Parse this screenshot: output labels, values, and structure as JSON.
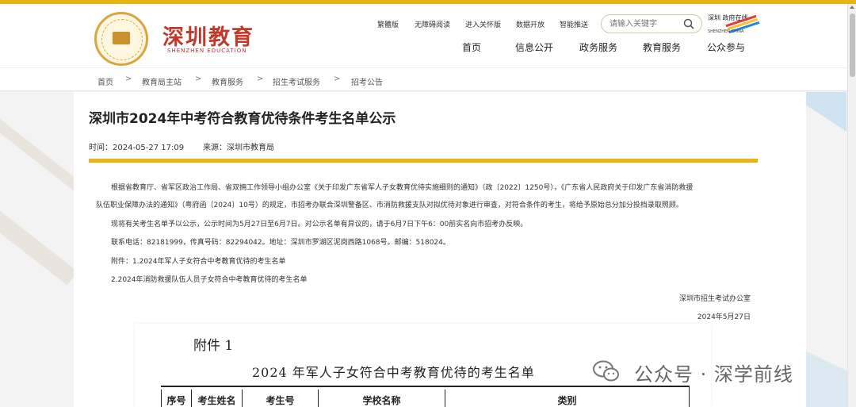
{
  "site": {
    "title": "深圳教育",
    "subtitle": "SHENZHEN EDUCATION",
    "badge_text": "深圳教育",
    "accent_color": "#e7b413",
    "brand_color": "#c0392b"
  },
  "utility_links": [
    "繁體版",
    "无障碍阅读",
    "进入关怀版",
    "数据开放",
    "智能推送"
  ],
  "search": {
    "placeholder": "请输入关键字",
    "icon": "search-icon"
  },
  "china_logo": {
    "text": "深圳 政府在线",
    "subtext": "SHENZHEN CHINA"
  },
  "nav": [
    "首页",
    "信息公开",
    "政务服务",
    "教育服务",
    "公众参与"
  ],
  "breadcrumb": [
    "首页",
    "教育局主站",
    "教育服务",
    "招生考试服务",
    "招考公告"
  ],
  "breadcrumb_separator": ">",
  "article": {
    "title": "深圳市2024年中考符合教育优待条件考生名单公示",
    "time": "时间：2024-05-27 17:09",
    "source": "来源：深圳市教育局",
    "paragraphs": [
      "根据省教育厅、省军区政治工作局、省双拥工作领导小组办公室《关于印发广东省军人子女教育优待实施细则的通知》（政〔2022〕1250号），《广东省人民政府关于印发广东省消防救援",
      "队伍职业保障办法的通知》（粤府函〔2024〕10号）的规定，市招考办联合深圳警备区、市消防救援支队对拟优待对象进行审查，对符合条件的考生，将给予原始总分加分投档录取照顾。",
      "现将有关考生名单予以公示，公示时间为5月27日至6月7日。对公示名单有异议的，请于6月7日下午6：00前实名向市招考办反映。",
      "联系电话：82181999，传真号码：82294042。地址：深圳市罗湖区泥岗西路1068号。邮编：518024。",
      "附件：1.2024年军人子女符合中考教育优待的考生名单",
      "2.2024年消防救援队伍人员子女符合中考教育优待的考生名单"
    ],
    "signoff_org": "深圳市招生考试办公室",
    "signoff_date": "2024年5月27日"
  },
  "attachment": {
    "label": "附件 1",
    "title": "2024 年军人子女符合中考教育优待的考生名单",
    "columns": [
      "序号",
      "考生姓名",
      "考生号",
      "学校名称",
      "类别"
    ]
  },
  "watermark": {
    "text": "公众号 · 深学前线",
    "icon": "wechat-icon"
  }
}
